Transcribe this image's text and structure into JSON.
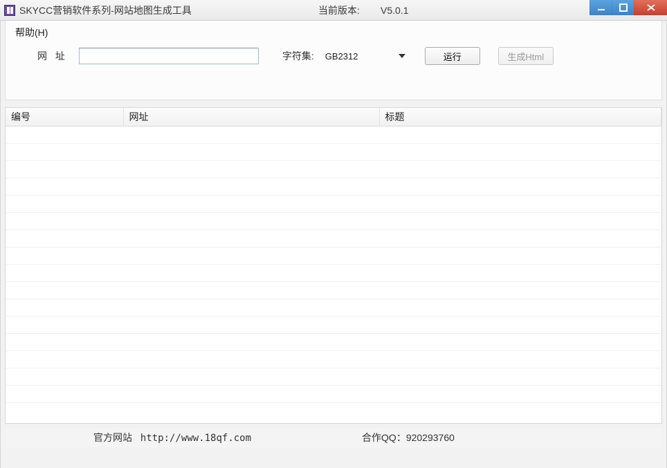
{
  "window": {
    "title": "SKYCC营销软件系列-网站地图生成工具",
    "version_label": "当前版本:",
    "version_value": "V5.0.1"
  },
  "menu": {
    "help": "帮助(H)"
  },
  "toolbar": {
    "url_label": "网 址",
    "url_value": "",
    "charset_label": "字符集:",
    "charset_value": "GB2312",
    "run_label": "运行",
    "generate_label": "生成Html"
  },
  "table": {
    "columns": {
      "num": "编号",
      "url": "网址",
      "title": "标题"
    },
    "rows": []
  },
  "footer": {
    "official_label": "官方网站",
    "official_url": "http://www.18qf.com",
    "qq_label": "合作QQ：",
    "qq_value": "920293760"
  }
}
